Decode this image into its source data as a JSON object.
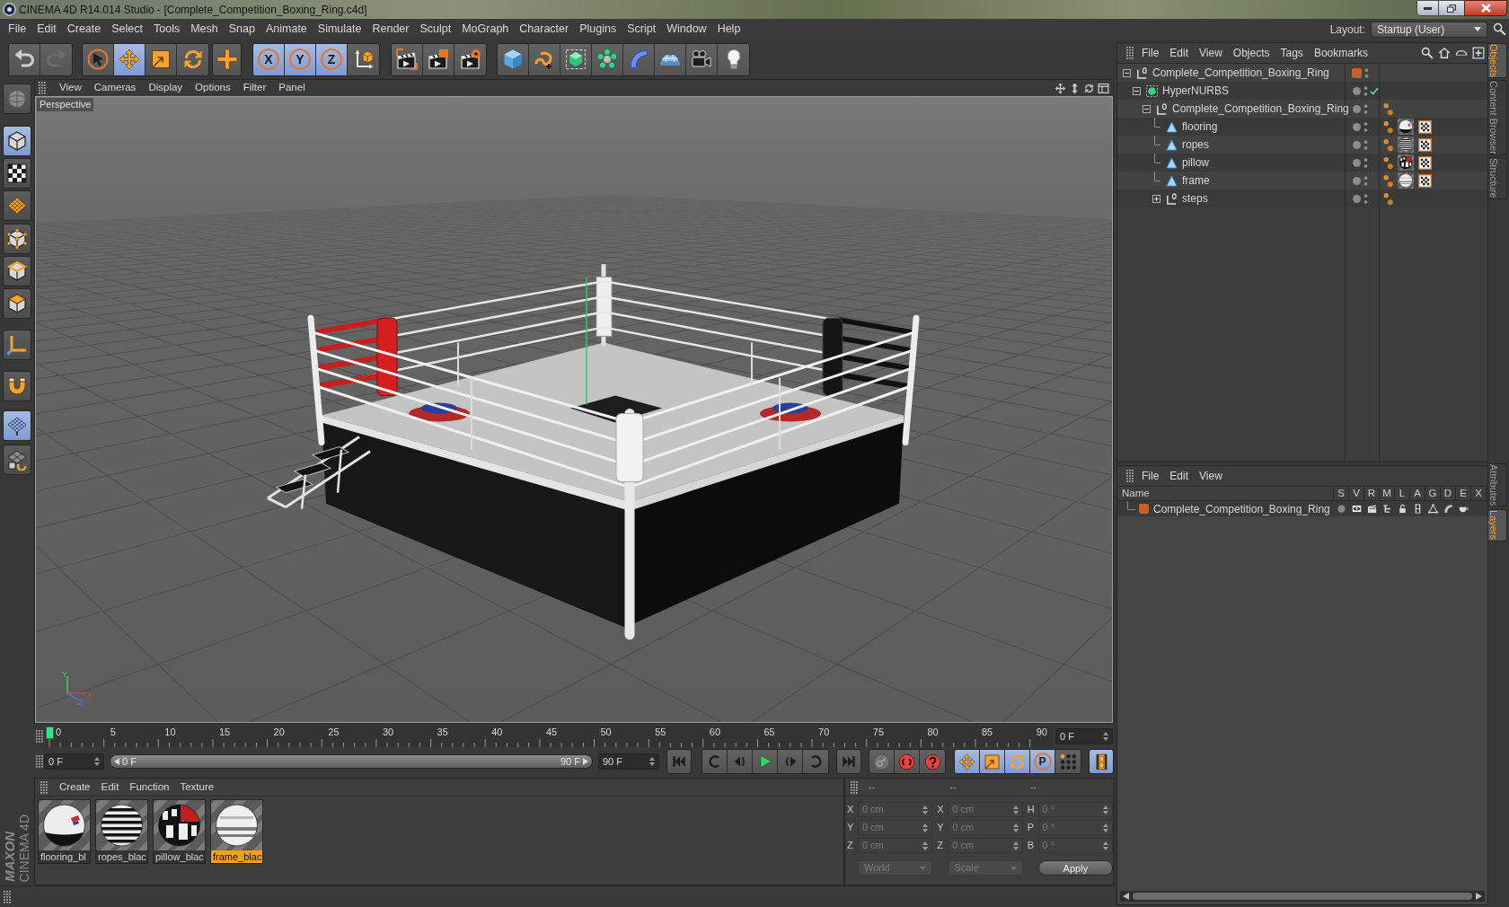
{
  "window": {
    "title": "CINEMA 4D R14.014 Studio - [Complete_Competition_Boxing_Ring.c4d]"
  },
  "menu_bar": {
    "items": [
      "File",
      "Edit",
      "Create",
      "Select",
      "Tools",
      "Mesh",
      "Snap",
      "Animate",
      "Simulate",
      "Render",
      "Sculpt",
      "MoGraph",
      "Character",
      "Plugins",
      "Script",
      "Window",
      "Help"
    ],
    "layout_label": "Layout:",
    "layout_value": "Startup (User)"
  },
  "toolbar": {
    "history": [
      {
        "disabled": false
      },
      {
        "disabled": true
      }
    ],
    "tools": [
      {
        "selected": false
      },
      {
        "selected": true
      },
      {
        "selected": false
      },
      {
        "selected": false
      },
      {
        "selected": false
      }
    ],
    "axes": [
      {
        "label": "X",
        "selected": true
      },
      {
        "label": "Y",
        "selected": true
      },
      {
        "label": "Z",
        "selected": true
      }
    ],
    "world_coordinates": {
      "selected": false
    }
  },
  "left_toolbar": [
    {
      "selected": false
    },
    {
      "selected": true
    },
    {
      "selected": false
    },
    {
      "selected": false
    },
    {
      "selected": false
    },
    {
      "selected": false
    },
    {
      "selected": false
    },
    {
      "selected": false
    },
    {
      "selected": false
    },
    {
      "selected": true
    },
    {
      "selected": false
    }
  ],
  "viewport": {
    "menu": [
      "View",
      "Cameras",
      "Display",
      "Options",
      "Filter",
      "Panel"
    ],
    "camera": "Perspective",
    "axis_labels": [
      "Y",
      "X",
      "Z"
    ]
  },
  "timeline": {
    "labels": [
      "0",
      "5",
      "10",
      "15",
      "20",
      "25",
      "30",
      "35",
      "40",
      "45",
      "50",
      "55",
      "60",
      "65",
      "70",
      "75",
      "80",
      "85",
      "90"
    ],
    "level": 0,
    "current_frame": "0 F"
  },
  "transport": {
    "start_field": "0 F",
    "range_start": "0 F",
    "range_end": "90 F",
    "end_field": "90 F",
    "key_tracks": [
      {
        "selected": true
      },
      {
        "selected": true
      },
      {
        "selected": true
      },
      {
        "label": "P",
        "selected": true
      },
      {
        "selected": false
      }
    ],
    "timeline_toggle": {
      "selected": true
    }
  },
  "logo": {
    "brand": "MAXON",
    "product": "CINEMA 4D"
  },
  "materials": {
    "menu": [
      "Create",
      "Edit",
      "Function",
      "Texture"
    ],
    "items": [
      {
        "name": "flooring_bl",
        "selected": false
      },
      {
        "name": "ropes_blac",
        "selected": false
      },
      {
        "name": "pillow_blac",
        "selected": false
      },
      {
        "name": "frame_blac",
        "selected": true
      }
    ]
  },
  "coordinates": {
    "headers": [
      "--",
      "--",
      "--"
    ],
    "disabled": true,
    "rows": [
      [
        {
          "axis": "X",
          "value": "0 cm"
        },
        {
          "axis": "X",
          "value": "0 cm"
        },
        {
          "axis": "H",
          "value": "0 °"
        }
      ],
      [
        {
          "axis": "Y",
          "value": "0 cm"
        },
        {
          "axis": "Y",
          "value": "0 cm"
        },
        {
          "axis": "P",
          "value": "0 °"
        }
      ],
      [
        {
          "axis": "Z",
          "value": "0 cm"
        },
        {
          "axis": "Z",
          "value": "0 cm"
        },
        {
          "axis": "B",
          "value": "0 °"
        }
      ]
    ],
    "dropdowns": [
      "World",
      "Scale"
    ],
    "apply": "Apply"
  },
  "objects": {
    "menu": [
      "File",
      "Edit",
      "View",
      "Objects",
      "Tags",
      "Bookmarks"
    ],
    "tree": [
      {
        "name": "Complete_Competition_Boxing_Ring",
        "kind": "null",
        "expanded": true,
        "color": "#c8602c",
        "children": [
          {
            "name": "HyperNURBS",
            "kind": "nurbs",
            "expanded": true,
            "enabled": true,
            "children": [
              {
                "name": "Complete_Competition_Boxing_Ring",
                "kind": "null",
                "expanded": true,
                "tags": [
                  {
                    "kind": "phong"
                  }
                ],
                "children": [
                  {
                    "name": "flooring",
                    "kind": "polygon",
                    "tags": [
                      {
                        "kind": "phong"
                      },
                      {
                        "kind": "material"
                      },
                      {
                        "kind": "uvw"
                      }
                    ]
                  },
                  {
                    "name": "ropes",
                    "kind": "polygon",
                    "tags": [
                      {
                        "kind": "phong"
                      },
                      {
                        "kind": "material"
                      },
                      {
                        "kind": "uvw"
                      }
                    ]
                  },
                  {
                    "name": "pillow",
                    "kind": "polygon",
                    "tags": [
                      {
                        "kind": "phong"
                      },
                      {
                        "kind": "material"
                      },
                      {
                        "kind": "uvw"
                      }
                    ]
                  },
                  {
                    "name": "frame",
                    "kind": "polygon",
                    "tags": [
                      {
                        "kind": "phong"
                      },
                      {
                        "kind": "material"
                      },
                      {
                        "kind": "uvw"
                      }
                    ]
                  },
                  {
                    "name": "steps",
                    "kind": "null",
                    "expanded": false,
                    "tags": [
                      {
                        "kind": "phong"
                      }
                    ]
                  }
                ]
              }
            ]
          }
        ]
      }
    ]
  },
  "layers": {
    "menu": [
      "File",
      "Edit",
      "View"
    ],
    "columns": [
      "Name",
      "S",
      "V",
      "R",
      "M",
      "L",
      "A",
      "G",
      "D",
      "E",
      "X"
    ],
    "rows": [
      {
        "name": "Complete_Competition_Boxing_Ring",
        "color": "#c8602c"
      }
    ]
  },
  "side_tabs": {
    "upper": [
      {
        "label": "Objects",
        "selected": true
      },
      {
        "label": "Content Browser",
        "selected": false
      },
      {
        "label": "Structure",
        "selected": false
      }
    ],
    "lower": [
      {
        "label": "Attributes",
        "selected": false
      },
      {
        "label": "Layers",
        "selected": true
      }
    ]
  }
}
